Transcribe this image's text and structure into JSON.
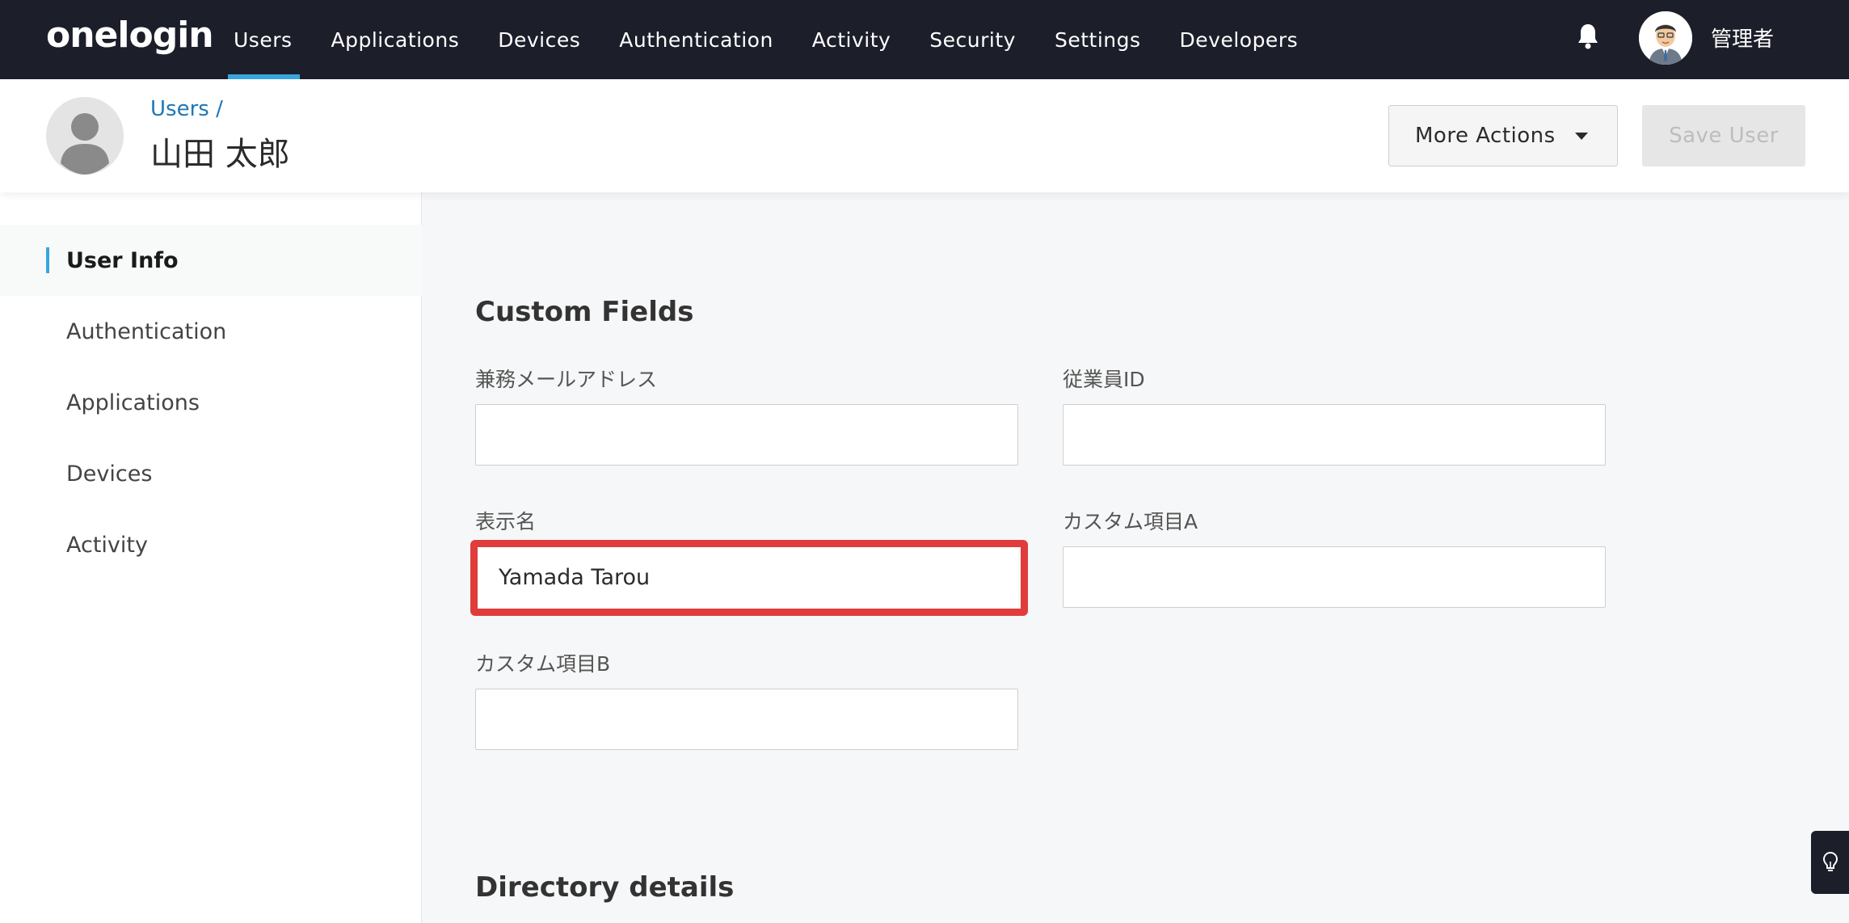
{
  "app": {
    "logo": "onelogin"
  },
  "topnav": {
    "items": [
      {
        "label": "Users"
      },
      {
        "label": "Applications"
      },
      {
        "label": "Devices"
      },
      {
        "label": "Authentication"
      },
      {
        "label": "Activity"
      },
      {
        "label": "Security"
      },
      {
        "label": "Settings"
      },
      {
        "label": "Developers"
      }
    ],
    "active": "Users",
    "admin_name": "管理者"
  },
  "header": {
    "breadcrumb": "Users /",
    "title": "山田 太郎",
    "more_actions": "More Actions",
    "save_user": "Save User"
  },
  "sidebar": {
    "items": [
      {
        "label": "User Info"
      },
      {
        "label": "Authentication"
      },
      {
        "label": "Applications"
      },
      {
        "label": "Devices"
      },
      {
        "label": "Activity"
      }
    ],
    "active": "User Info"
  },
  "custom_fields": {
    "title": "Custom Fields",
    "fields": [
      {
        "label": "兼務メールアドレス",
        "value": ""
      },
      {
        "label": "従業員ID",
        "value": ""
      },
      {
        "label": "表示名",
        "value": "Yamada Tarou"
      },
      {
        "label": "カスタム項目A",
        "value": ""
      },
      {
        "label": "カスタム項目B",
        "value": ""
      }
    ]
  },
  "directory": {
    "title": "Directory details"
  },
  "colors": {
    "nav_bg": "#1c1f2a",
    "accent": "#3aa6dd",
    "highlight": "#e03c3c",
    "link": "#1f77b4"
  }
}
